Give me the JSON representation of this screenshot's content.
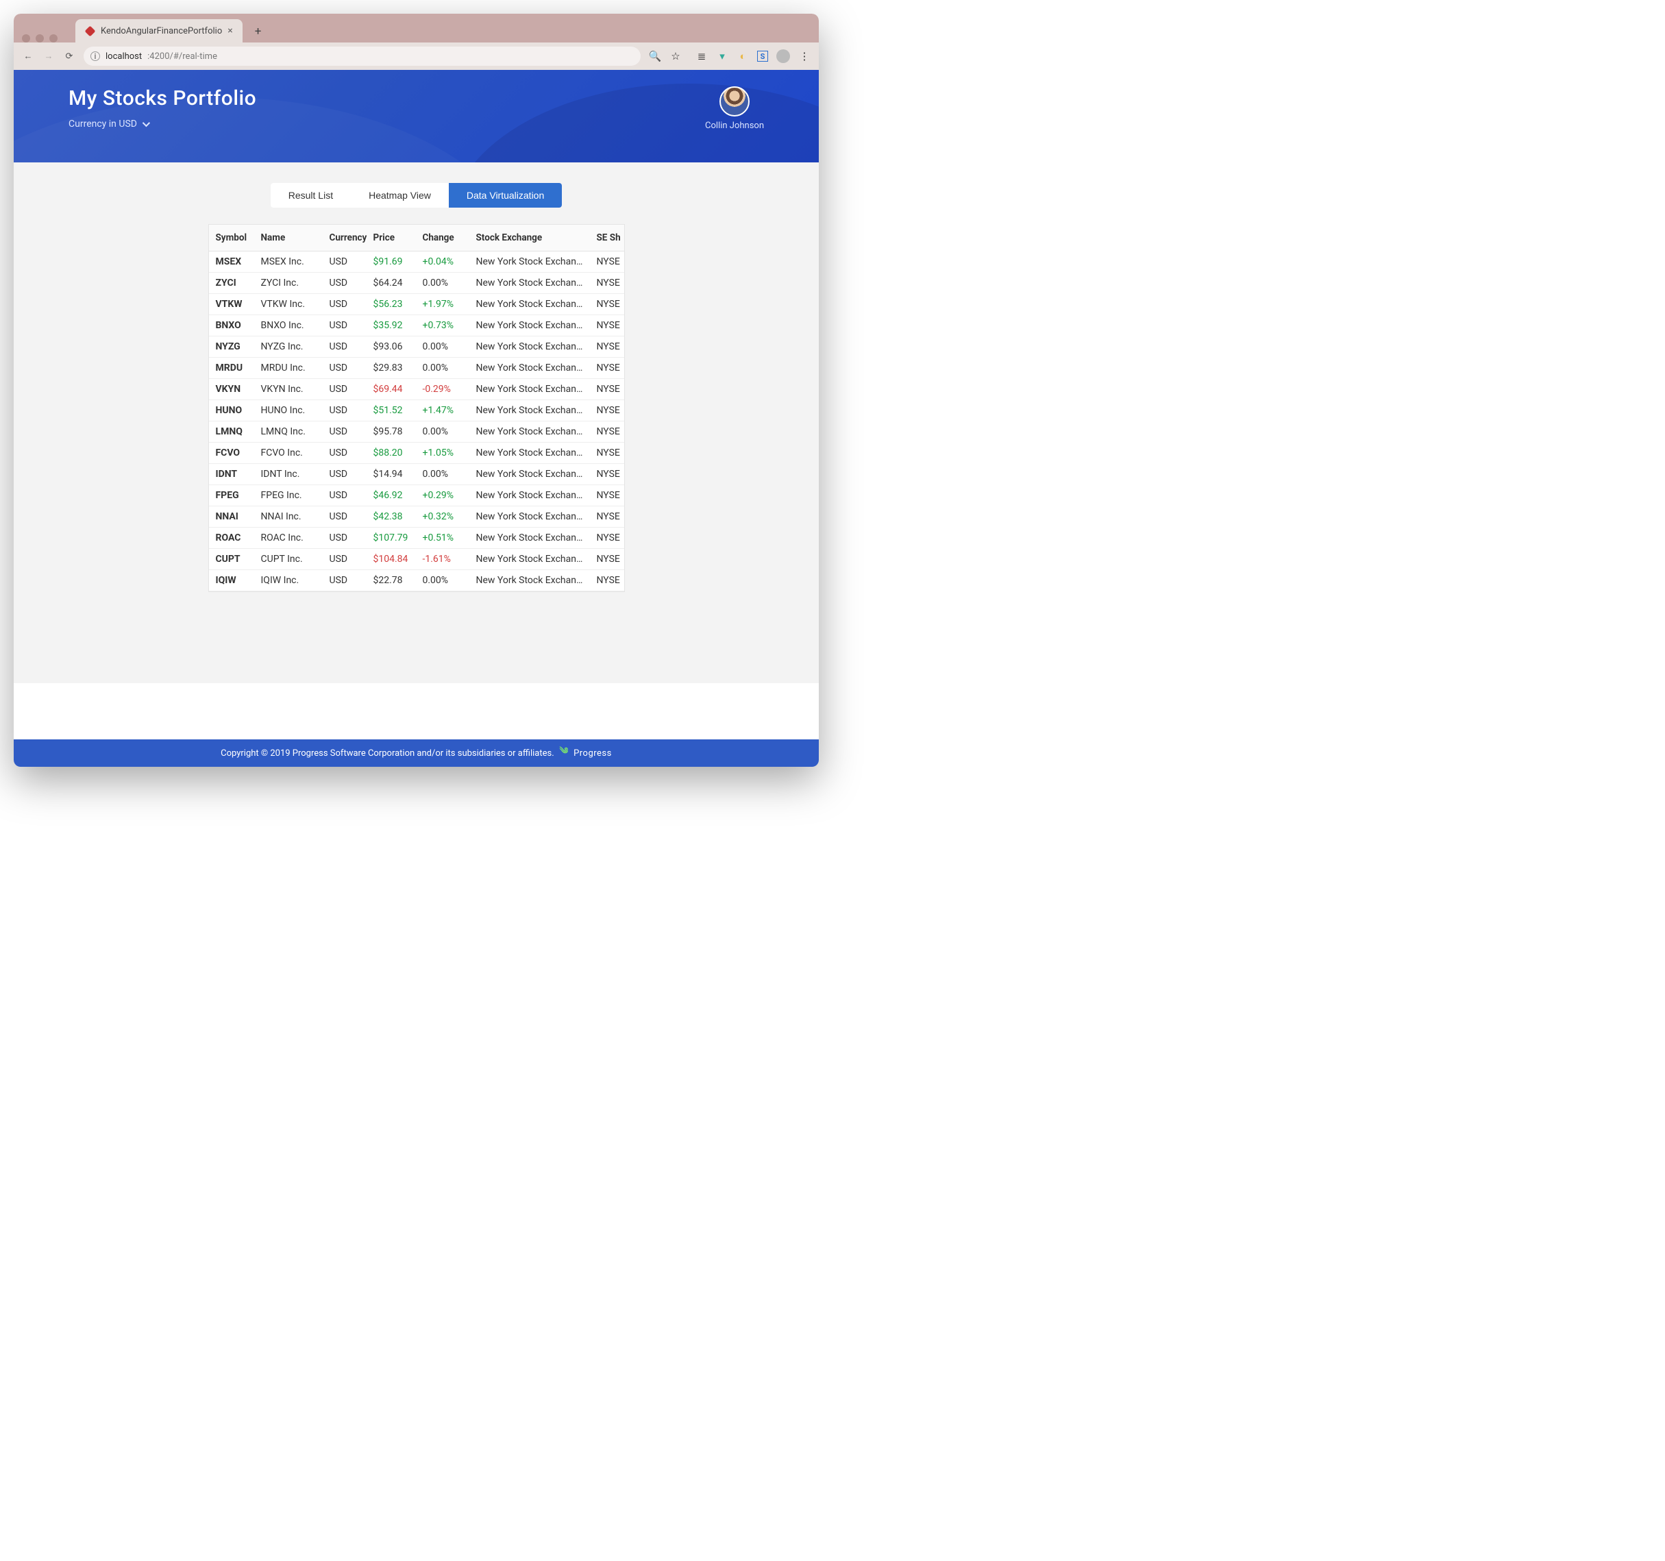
{
  "browser": {
    "tab_title": "KendoAngularFinancePortfolio",
    "url_host": "localhost",
    "url_rest": ":4200/#/real-time"
  },
  "header": {
    "title": "My Stocks Portfolio",
    "currency_label": "Currency in USD",
    "user_name": "Collin Johnson"
  },
  "tabs": {
    "items": [
      "Result List",
      "Heatmap View",
      "Data Virtualization"
    ],
    "active_index": 2
  },
  "table": {
    "columns": [
      "Symbol",
      "Name",
      "Currency",
      "Price",
      "Change",
      "Stock Exchange",
      "SE Short"
    ],
    "rows": [
      {
        "symbol": "MSEX",
        "name": "MSEX Inc.",
        "currency": "USD",
        "price": "$91.69",
        "change": "+0.04%",
        "dir": "up",
        "exchange": "New York Stock Exchange",
        "se": "NYSE"
      },
      {
        "symbol": "ZYCI",
        "name": "ZYCI Inc.",
        "currency": "USD",
        "price": "$64.24",
        "change": "0.00%",
        "dir": "flat",
        "exchange": "New York Stock Exchange",
        "se": "NYSE"
      },
      {
        "symbol": "VTKW",
        "name": "VTKW Inc.",
        "currency": "USD",
        "price": "$56.23",
        "change": "+1.97%",
        "dir": "up",
        "exchange": "New York Stock Exchange",
        "se": "NYSE"
      },
      {
        "symbol": "BNXO",
        "name": "BNXO Inc.",
        "currency": "USD",
        "price": "$35.92",
        "change": "+0.73%",
        "dir": "up",
        "exchange": "New York Stock Exchange",
        "se": "NYSE"
      },
      {
        "symbol": "NYZG",
        "name": "NYZG Inc.",
        "currency": "USD",
        "price": "$93.06",
        "change": "0.00%",
        "dir": "flat",
        "exchange": "New York Stock Exchange",
        "se": "NYSE"
      },
      {
        "symbol": "MRDU",
        "name": "MRDU Inc.",
        "currency": "USD",
        "price": "$29.83",
        "change": "0.00%",
        "dir": "flat",
        "exchange": "New York Stock Exchange",
        "se": "NYSE"
      },
      {
        "symbol": "VKYN",
        "name": "VKYN Inc.",
        "currency": "USD",
        "price": "$69.44",
        "change": "-0.29%",
        "dir": "down",
        "exchange": "New York Stock Exchange",
        "se": "NYSE"
      },
      {
        "symbol": "HUNO",
        "name": "HUNO Inc.",
        "currency": "USD",
        "price": "$51.52",
        "change": "+1.47%",
        "dir": "up",
        "exchange": "New York Stock Exchange",
        "se": "NYSE"
      },
      {
        "symbol": "LMNQ",
        "name": "LMNQ Inc.",
        "currency": "USD",
        "price": "$95.78",
        "change": "0.00%",
        "dir": "flat",
        "exchange": "New York Stock Exchange",
        "se": "NYSE"
      },
      {
        "symbol": "FCVO",
        "name": "FCVO Inc.",
        "currency": "USD",
        "price": "$88.20",
        "change": "+1.05%",
        "dir": "up",
        "exchange": "New York Stock Exchange",
        "se": "NYSE"
      },
      {
        "symbol": "IDNT",
        "name": "IDNT Inc.",
        "currency": "USD",
        "price": "$14.94",
        "change": "0.00%",
        "dir": "flat",
        "exchange": "New York Stock Exchange",
        "se": "NYSE"
      },
      {
        "symbol": "FPEG",
        "name": "FPEG Inc.",
        "currency": "USD",
        "price": "$46.92",
        "change": "+0.29%",
        "dir": "up",
        "exchange": "New York Stock Exchange",
        "se": "NYSE"
      },
      {
        "symbol": "NNAI",
        "name": "NNAI Inc.",
        "currency": "USD",
        "price": "$42.38",
        "change": "+0.32%",
        "dir": "up",
        "exchange": "New York Stock Exchange",
        "se": "NYSE"
      },
      {
        "symbol": "ROAC",
        "name": "ROAC Inc.",
        "currency": "USD",
        "price": "$107.79",
        "change": "+0.51%",
        "dir": "up",
        "exchange": "New York Stock Exchange",
        "se": "NYSE"
      },
      {
        "symbol": "CUPT",
        "name": "CUPT Inc.",
        "currency": "USD",
        "price": "$104.84",
        "change": "-1.61%",
        "dir": "down",
        "exchange": "New York Stock Exchange",
        "se": "NYSE"
      },
      {
        "symbol": "IQIW",
        "name": "IQIW Inc.",
        "currency": "USD",
        "price": "$22.78",
        "change": "0.00%",
        "dir": "flat",
        "exchange": "New York Stock Exchange",
        "se": "NYSE"
      }
    ]
  },
  "footer": {
    "text": "Copyright © 2019 Progress Software Corporation and/or its subsidiaries or affiliates.",
    "brand": "Progress"
  }
}
